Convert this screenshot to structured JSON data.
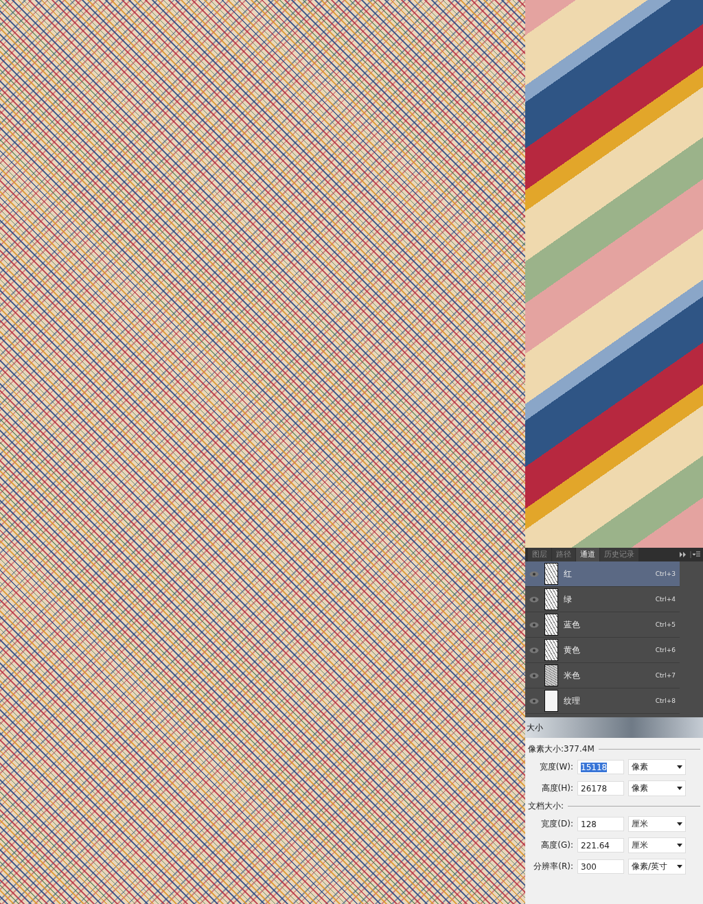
{
  "panel": {
    "tabs": [
      {
        "label": "图层",
        "selected": false
      },
      {
        "label": "路径",
        "selected": false
      },
      {
        "label": "通道",
        "selected": true
      },
      {
        "label": "历史记录",
        "selected": false
      }
    ],
    "channels": [
      {
        "name": "红",
        "shortcut": "Ctrl+3",
        "selected": true,
        "visible": true,
        "kind": "light"
      },
      {
        "name": "绿",
        "shortcut": "Ctrl+4",
        "selected": false,
        "visible": true,
        "kind": "light"
      },
      {
        "name": "蓝色",
        "shortcut": "Ctrl+5",
        "selected": false,
        "visible": true,
        "kind": "light"
      },
      {
        "name": "黄色",
        "shortcut": "Ctrl+6",
        "selected": false,
        "visible": true,
        "kind": "light"
      },
      {
        "name": "米色",
        "shortcut": "Ctrl+7",
        "selected": false,
        "visible": true,
        "kind": "dark"
      },
      {
        "name": "纹理",
        "shortcut": "Ctrl+8",
        "selected": false,
        "visible": true,
        "kind": "blank"
      }
    ]
  },
  "dialog": {
    "title": "大小",
    "pixel_size": "像素大小:377.4M",
    "pixel_fields": [
      {
        "label": "宽度(W):",
        "value": "15118",
        "unit": "像素",
        "selected": true
      },
      {
        "label": "高度(H):",
        "value": "26178",
        "unit": "像素",
        "selected": false
      }
    ],
    "document_size": "文档大小:",
    "document_fields": [
      {
        "label": "宽度(D):",
        "value": "128",
        "unit": "厘米",
        "selected": false
      },
      {
        "label": "高度(G):",
        "value": "221.64",
        "unit": "厘米",
        "selected": false
      },
      {
        "label": "分辨率(R):",
        "value": "300",
        "unit": "像素/英寸",
        "selected": false
      }
    ]
  }
}
